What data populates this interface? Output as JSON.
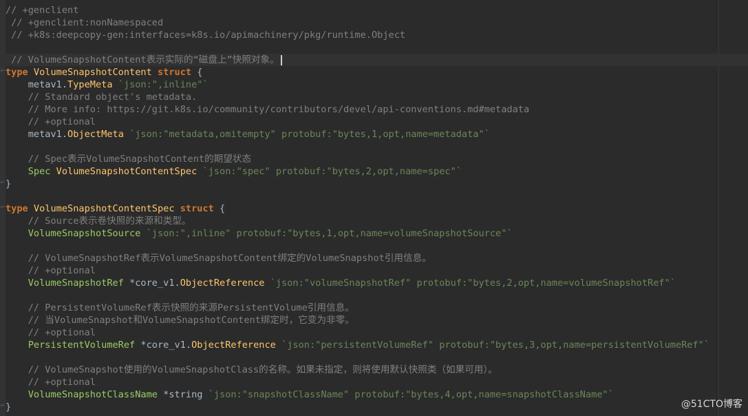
{
  "lines": [
    {
      "segs": [
        {
          "c": "c",
          "t": "// +genclient"
        }
      ]
    },
    {
      "segs": [
        {
          "c": "c",
          "t": " // +genclient:nonNamespaced"
        }
      ]
    },
    {
      "segs": [
        {
          "c": "c",
          "t": " // +k8s:deepcopy-gen:interfaces=k8s.io/apimachinery/pkg/runtime.Object"
        }
      ]
    },
    {
      "segs": []
    },
    {
      "current": true,
      "caret": true,
      "segs": [
        {
          "c": "c",
          "t": " // VolumeSnapshotContent表示实际的“磁盘上”快照对象。"
        }
      ]
    },
    {
      "segs": [
        {
          "c": "k",
          "t": "type "
        },
        {
          "c": "ty",
          "t": "VolumeSnapshotContent "
        },
        {
          "c": "k",
          "t": "struct"
        },
        {
          "c": "id",
          "t": " {"
        }
      ]
    },
    {
      "segs": [
        {
          "c": "id",
          "t": "    metav1."
        },
        {
          "c": "ty",
          "t": "TypeMeta "
        },
        {
          "c": "tg",
          "t": "`json:\",inline\"`"
        }
      ]
    },
    {
      "segs": [
        {
          "c": "c",
          "t": "    // Standard object's metadata."
        }
      ]
    },
    {
      "segs": [
        {
          "c": "c",
          "t": "    // More info: https://git.k8s.io/community/contributors/devel/api-conventions.md#metadata"
        }
      ]
    },
    {
      "segs": [
        {
          "c": "c",
          "t": "    // +optional"
        }
      ]
    },
    {
      "segs": [
        {
          "c": "id",
          "t": "    metav1."
        },
        {
          "c": "ty",
          "t": "ObjectMeta "
        },
        {
          "c": "tg",
          "t": "`json:\"metadata,omitempty\" protobuf:\"bytes,1,opt,name=metadata\"`"
        }
      ]
    },
    {
      "segs": []
    },
    {
      "segs": [
        {
          "c": "c",
          "t": "    // Spec表示VolumeSnapshotContent的期望状态"
        }
      ]
    },
    {
      "segs": [
        {
          "c": "fg",
          "t": "    Spec "
        },
        {
          "c": "ty",
          "t": "VolumeSnapshotContentSpec "
        },
        {
          "c": "tg",
          "t": "`json:\"spec\" protobuf:\"bytes,2,opt,name=spec\"`"
        }
      ]
    },
    {
      "segs": [
        {
          "c": "id",
          "t": "}"
        }
      ]
    },
    {
      "segs": []
    },
    {
      "segs": [
        {
          "c": "k",
          "t": "type "
        },
        {
          "c": "ty",
          "t": "VolumeSnapshotContentSpec "
        },
        {
          "c": "k",
          "t": "struct"
        },
        {
          "c": "id",
          "t": " {"
        }
      ]
    },
    {
      "segs": [
        {
          "c": "c",
          "t": "    // Source表示卷快照的来源和类型。"
        }
      ]
    },
    {
      "segs": [
        {
          "c": "fg",
          "t": "    VolumeSnapshotSource "
        },
        {
          "c": "tg",
          "t": "`json:\",inline\" protobuf:\"bytes,1,opt,name=volumeSnapshotSource\"`"
        }
      ]
    },
    {
      "segs": []
    },
    {
      "segs": [
        {
          "c": "c",
          "t": "    // VolumeSnapshotRef表示VolumeSnapshotContent绑定的VolumeSnapshot引用信息。"
        }
      ]
    },
    {
      "segs": [
        {
          "c": "c",
          "t": "    // +optional"
        }
      ]
    },
    {
      "segs": [
        {
          "c": "fg",
          "t": "    VolumeSnapshotRef "
        },
        {
          "c": "id",
          "t": "*core_v1."
        },
        {
          "c": "ty",
          "t": "ObjectReference "
        },
        {
          "c": "tg",
          "t": "`json:\"volumeSnapshotRef\" protobuf:\"bytes,2,opt,name=volumeSnapshotRef\"`"
        }
      ]
    },
    {
      "segs": []
    },
    {
      "segs": [
        {
          "c": "c",
          "t": "    // PersistentVolumeRef表示快照的来源PersistentVolume引用信息。"
        }
      ]
    },
    {
      "segs": [
        {
          "c": "c",
          "t": "    // 当VolumeSnapshot和VolumeSnapshotContent绑定时，它变为非零。"
        }
      ]
    },
    {
      "segs": [
        {
          "c": "c",
          "t": "    // +optional"
        }
      ]
    },
    {
      "segs": [
        {
          "c": "fg",
          "t": "    PersistentVolumeRef "
        },
        {
          "c": "id",
          "t": "*core_v1."
        },
        {
          "c": "ty",
          "t": "ObjectReference "
        },
        {
          "c": "tg",
          "t": "`json:\"persistentVolumeRef\" protobuf:\"bytes,3,opt,name=persistentVolumeRef\"`"
        }
      ]
    },
    {
      "segs": []
    },
    {
      "segs": [
        {
          "c": "c",
          "t": "    // VolumeSnapshot使用的VolumeSnapshotClass的名称。如果未指定，则将使用默认快照类（如果可用）。"
        }
      ]
    },
    {
      "segs": [
        {
          "c": "c",
          "t": "    // +optional"
        }
      ]
    },
    {
      "segs": [
        {
          "c": "fg",
          "t": "    VolumeSnapshotClassName "
        },
        {
          "c": "id",
          "t": "*string "
        },
        {
          "c": "tg",
          "t": "`json:\"snapshotClassName\" protobuf:\"bytes,4,opt,name=snapshotClassName\"`"
        }
      ]
    },
    {
      "segs": [
        {
          "c": "id",
          "t": "}"
        }
      ]
    }
  ],
  "watermark": "@51CTO博客",
  "colors": {
    "background": "#2b2b2b",
    "comment": "#808080",
    "keyword": "#cc7832",
    "type": "#ffc66d",
    "tag": "#6a8759",
    "field": "#9ccc65",
    "text": "#a9b7c6"
  }
}
